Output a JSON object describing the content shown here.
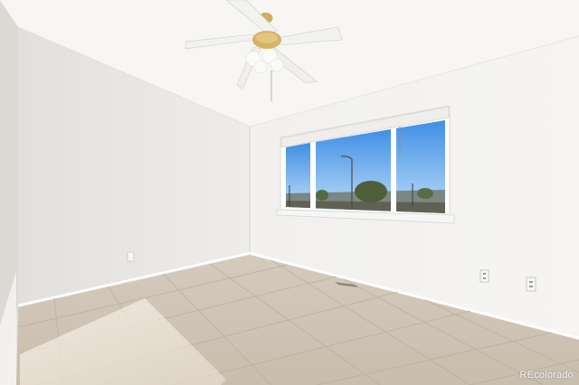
{
  "watermark": {
    "text": "REcolorado"
  },
  "colors": {
    "wall_light": "#f4f3f1",
    "wall_shadow": "#e6e4e1",
    "ceiling": "#f7f6f4",
    "floor": "#cfc4b6",
    "floor_grout": "#b9ad9e",
    "sky_top": "#3f8fe6",
    "sky_bottom": "#bcdcf6",
    "fan_blade": "#f2f2f0",
    "fan_brass": "#c9a85a"
  },
  "icons": [
    "ceiling-fan-icon",
    "electrical-outlet-icon",
    "floor-vent-icon"
  ]
}
